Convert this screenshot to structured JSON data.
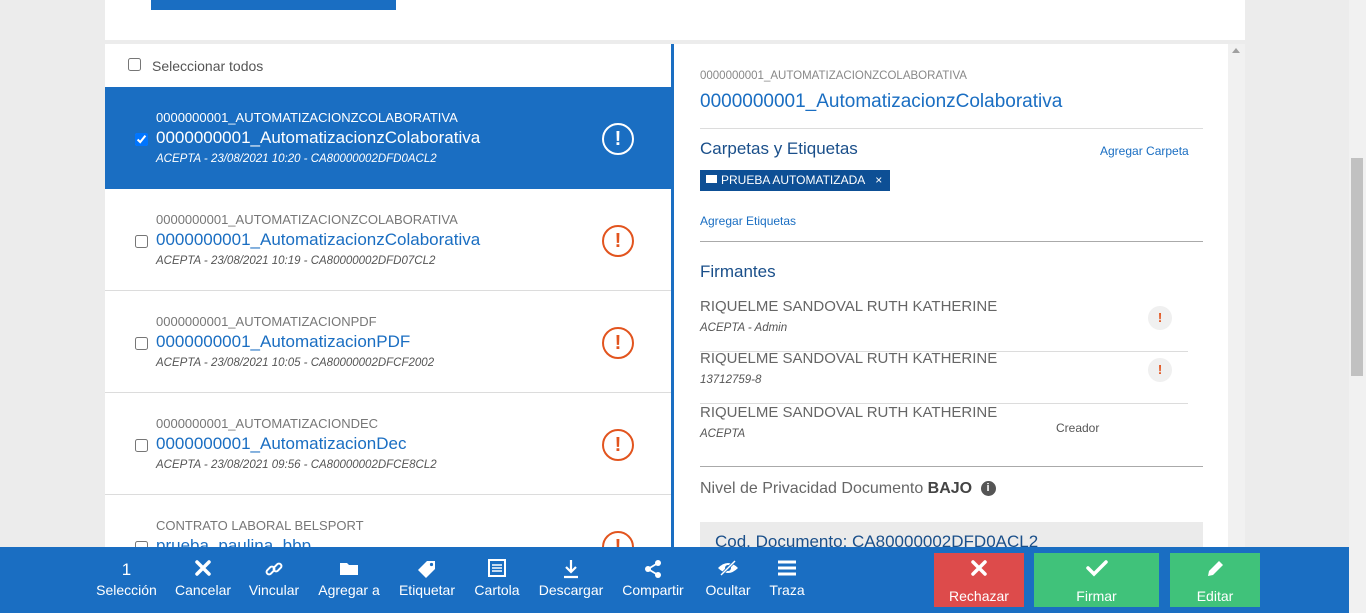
{
  "colors": {
    "primary": "#1a6ec2",
    "reject": "#dd4b4b",
    "approve": "#40c27a",
    "warning": "#e2541e",
    "chip": "#0d4f95"
  },
  "list": {
    "select_all": "Seleccionar todos",
    "items": [
      {
        "code": "0000000001_AUTOMATIZACIONZCOLABORATIVA",
        "name": "0000000001_AutomatizacionzColaborativa",
        "meta": "ACEPTA - 23/08/2021 10:20 - CA80000002DFD0ACL2",
        "checked": true,
        "icon": "warning-circle-icon"
      },
      {
        "code": "0000000001_AUTOMATIZACIONZCOLABORATIVA",
        "name": "0000000001_AutomatizacionzColaborativa",
        "meta": "ACEPTA - 23/08/2021 10:19 - CA80000002DFD07CL2",
        "checked": false,
        "icon": "warning-circle-icon"
      },
      {
        "code": "0000000001_AUTOMATIZACIONPDF",
        "name": "0000000001_AutomatizacionPDF",
        "meta": "ACEPTA - 23/08/2021 10:05 - CA80000002DFCF2002",
        "checked": false,
        "icon": "warning-circle-icon"
      },
      {
        "code": "0000000001_AUTOMATIZACIONDEC",
        "name": "0000000001_AutomatizacionDec",
        "meta": "ACEPTA - 23/08/2021 09:56 - CA80000002DFCE8CL2",
        "checked": false,
        "icon": "warning-circle-icon"
      },
      {
        "code": "CONTRATO LABORAL BELSPORT",
        "name": "prueba_paulina_bbp",
        "meta": "",
        "checked": false,
        "icon": "warning-circle-icon"
      }
    ]
  },
  "detail": {
    "code": "0000000001_AUTOMATIZACIONZCOLABORATIVA",
    "title": "0000000001_AutomatizacionzColaborativa",
    "folders_title": "Carpetas y Etiquetas",
    "add_folder": "Agregar Carpeta",
    "folder_chip": "PRUEBA AUTOMATIZADA",
    "chip_remove": "×",
    "add_tags": "Agregar Etiquetas",
    "signers_title": "Firmantes",
    "signers": [
      {
        "name": "RIQUELME SANDOVAL RUTH KATHERINE",
        "sub": "ACEPTA - Admin",
        "role": "",
        "badge": "!"
      },
      {
        "name": "RIQUELME SANDOVAL RUTH KATHERINE",
        "sub": "13712759-8",
        "role": "",
        "badge": "!"
      },
      {
        "name": "RIQUELME SANDOVAL RUTH KATHERINE",
        "sub": "ACEPTA",
        "role": "Creador",
        "badge": ""
      }
    ],
    "privacy_label": "Nivel de Privacidad Documento",
    "privacy_value": "BAJO",
    "doc_code": "Cod. Documento: CA80000002DFD0ACL2"
  },
  "toolbar": {
    "selection_count": "1",
    "selection_label": "Selección",
    "actions": [
      {
        "label": "Cancelar",
        "icon": "close-icon"
      },
      {
        "label": "Vincular",
        "icon": "link-icon"
      },
      {
        "label": "Agregar a",
        "icon": "folder-icon"
      },
      {
        "label": "Etiquetar",
        "icon": "tag-icon"
      },
      {
        "label": "Cartola",
        "icon": "list-doc-icon"
      },
      {
        "label": "Descargar",
        "icon": "download-icon"
      },
      {
        "label": "Compartir",
        "icon": "share-icon"
      },
      {
        "label": "Ocultar",
        "icon": "eye-slash-icon"
      },
      {
        "label": "Traza",
        "icon": "bars-icon"
      }
    ],
    "reject": "Rechazar",
    "sign": "Firmar",
    "edit": "Editar"
  }
}
